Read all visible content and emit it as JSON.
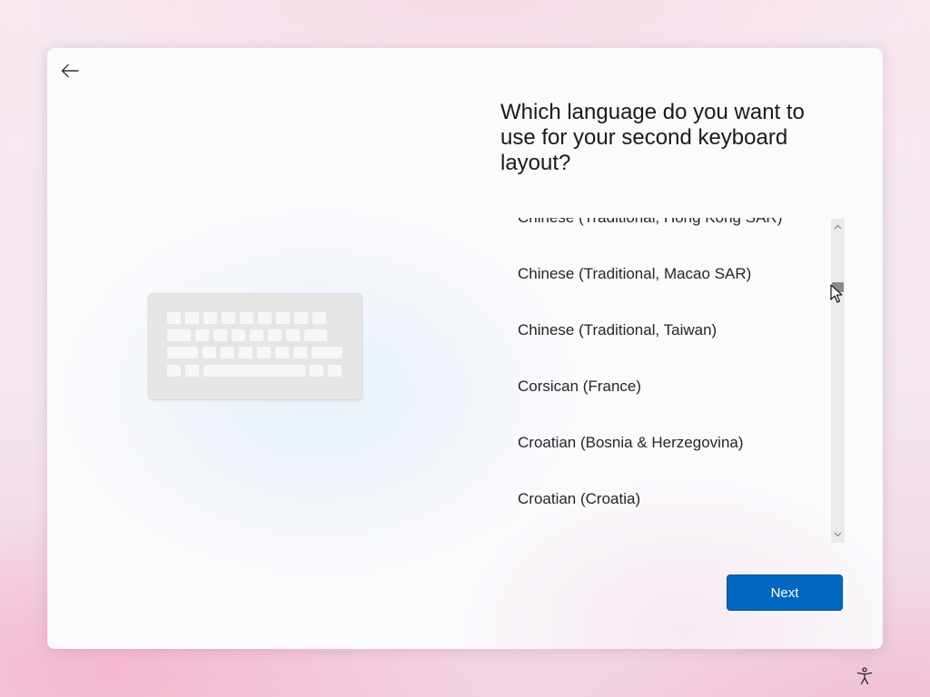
{
  "dialog": {
    "title": "Which language do you want to use for your second keyboard layout?",
    "languages": [
      "Chinese (Traditional, Hong Kong SAR)",
      "Chinese (Traditional, Macao SAR)",
      "Chinese (Traditional, Taiwan)",
      "Corsican (France)",
      "Croatian (Bosnia & Herzegovina)",
      "Croatian (Croatia)"
    ],
    "next_label": "Next"
  },
  "icons": {
    "back": "back-arrow-icon",
    "illustration": "keyboard-illustration-icon",
    "scroll_up": "chevron-up-icon",
    "scroll_down": "chevron-down-icon",
    "accessibility": "accessibility-icon"
  },
  "colors": {
    "accent": "#0067c0",
    "text": "#1a1a1a"
  }
}
